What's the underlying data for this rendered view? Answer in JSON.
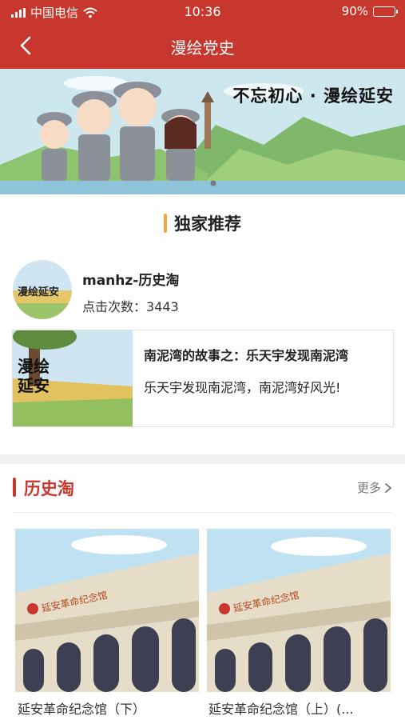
{
  "status": {
    "carrier": "中国电信",
    "time": "10:36",
    "battery": "90%",
    "battery_level": 0.9
  },
  "nav": {
    "title": "漫绘党史",
    "back_icon": "chevron-left-icon"
  },
  "banner": {
    "slogan": "不忘初心 · 漫绘延安",
    "carousel_index": 1,
    "carousel_count": 1
  },
  "recommend": {
    "heading": "独家推荐",
    "author": "manhz-历史淘",
    "click_label": "点击次数：",
    "click_count": "3443",
    "avatar_text": "漫绘延安",
    "card": {
      "title": "南泥湾的故事之：乐天宇发现南泥湾",
      "desc": "乐天宇发现南泥湾，南泥湾好风光!",
      "thumb_text_1": "漫绘",
      "thumb_text_2": "延安"
    }
  },
  "history": {
    "title": "历史淘",
    "more": "更多",
    "items": [
      {
        "caption": "延安革命纪念馆（下）",
        "sign": "延安革命纪念馆"
      },
      {
        "caption": "延安革命纪念馆（上）(...",
        "sign": "延安革命纪念馆"
      }
    ]
  },
  "colors": {
    "brand_red": "#c8372d",
    "accent_orange": "#f2a541",
    "divider_gray": "#f0f0f0"
  }
}
